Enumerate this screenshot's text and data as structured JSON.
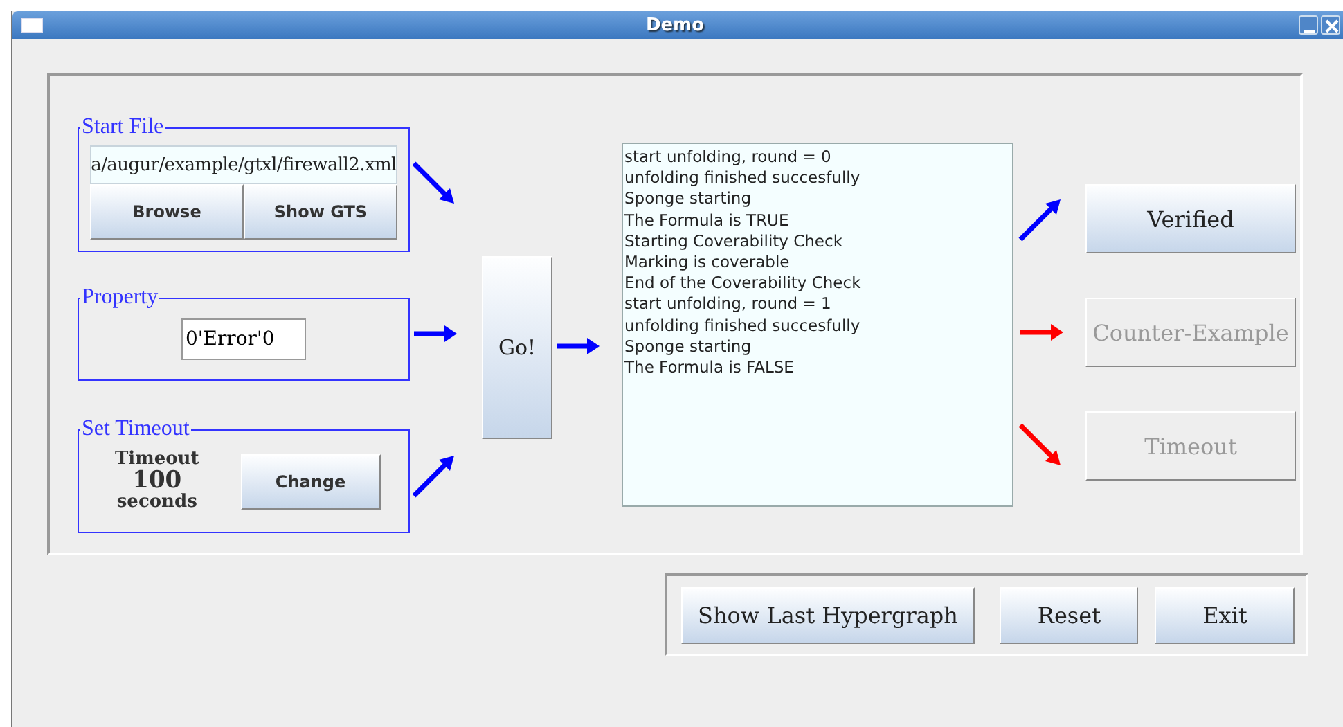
{
  "window": {
    "title": "Demo"
  },
  "start_file": {
    "legend": "Start File",
    "path": "a/augur/example/gtxl/firewall2.xml",
    "buttons": [
      "Browse",
      "Show GTS"
    ]
  },
  "property": {
    "legend": "Property",
    "value": "0'Error'0"
  },
  "set_timeout": {
    "legend": "Set Timeout",
    "label": "Timeout",
    "amount": "100",
    "unit": "seconds",
    "button": "Change"
  },
  "input_arrows": [
    {
      "kind": "down-right",
      "color": "#0000ff"
    },
    {
      "kind": "right",
      "color": "#0000ff"
    },
    {
      "kind": "up-right",
      "color": "#0000ff"
    }
  ],
  "go_button": "Go!",
  "go_arrow": {
    "kind": "right",
    "color": "#0000ff"
  },
  "log": [
    "start unfolding, round = 0",
    "unfolding finished succesfully",
    "Sponge starting",
    "The Formula is TRUE",
    "Starting Coverability Check",
    "Marking is coverable",
    "End of the Coverability Check",
    "start unfolding, round = 1",
    "unfolding finished succesfully",
    "Sponge starting",
    "The Formula is FALSE"
  ],
  "results": [
    {
      "label": "Verified",
      "disabled": false,
      "arrow": {
        "kind": "up-right",
        "color": "#0000ff"
      }
    },
    {
      "label": "Counter-Example",
      "disabled": true,
      "arrow": {
        "kind": "right",
        "color": "#ff0000"
      }
    },
    {
      "label": "Timeout",
      "disabled": true,
      "arrow": {
        "kind": "down-right",
        "color": "#ff0000"
      }
    }
  ],
  "bottom_buttons": [
    "Show Last Hypergraph",
    "Reset",
    "Exit"
  ]
}
